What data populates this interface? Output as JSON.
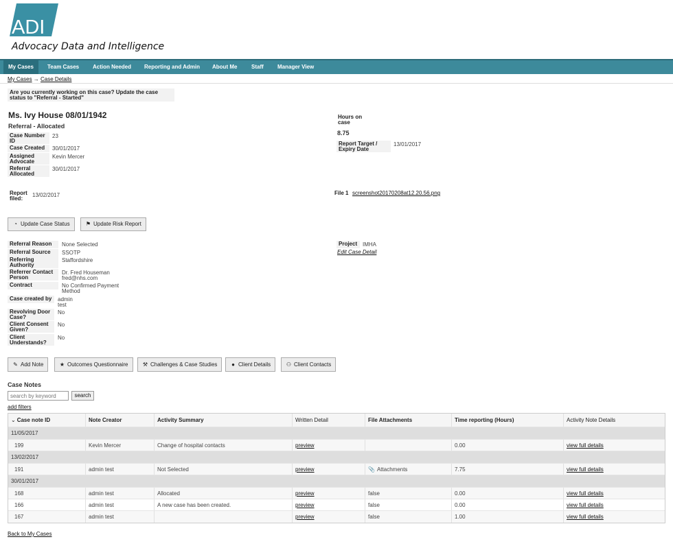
{
  "brand": {
    "logo_text": "ADI",
    "tagline": "Advocacy Data and Intelligence",
    "logo_color": "#3a90a4"
  },
  "nav": [
    "My Cases",
    "Team Cases",
    "Action Needed",
    "Reporting and Admin",
    "About Me",
    "Staff",
    "Manager View"
  ],
  "breadcrumb": {
    "root": "My Cases",
    "arrow": "→",
    "current": "Case Details"
  },
  "notice": "Are you currently working on this case? Update the case status to \"Referral - Started\"",
  "case": {
    "title": "Ms. Ivy House 08/01/1942",
    "status": "Referral - Allocated",
    "number_label": "Case Number ID",
    "number": "23",
    "created_label": "Case Created",
    "created": "30/01/2017",
    "advocate_label": "Assigned Advocate",
    "advocate": "Kevin Mercer",
    "allocated_label": "Referral Allocated",
    "allocated": "30/01/2017",
    "hours_label": "Hours on case",
    "hours": "8.75",
    "report_target_label": "Report Target / Expiry Date",
    "report_target": "13/01/2017",
    "report_filed_label": "Report filed:",
    "report_filed": "13/02/2017",
    "file_label": "File 1",
    "file_name": "screenshot20170208at12.20.56.png"
  },
  "actions_top": {
    "update_status": "Update Case Status",
    "update_risk": "Update Risk Report"
  },
  "referral": {
    "reason_label": "Referral Reason",
    "reason": "None Selected",
    "source_label": "Referral Source",
    "source": "SSOTP",
    "authority_label": "Referring Authority",
    "authority": "Staffordshire",
    "contact_label": "Referrer Contact Person",
    "contact_name": "Dr. Fred Houseman",
    "contact_email": "fred@nhs.com",
    "contract_label": "Contract",
    "contract": "No Confirmed Payment Method",
    "created_by_label": "Case created by",
    "created_by_1": "admin",
    "created_by_2": "test",
    "revolving_label": "Revolving Door Case?",
    "revolving": "No",
    "consent_label": "Client Consent Given?",
    "consent": "No",
    "understands_label": "Client Understands?",
    "understands": "No",
    "project_label": "Project",
    "project": "IMHA",
    "edit_link": "Edit Case Detail"
  },
  "actions_mid": {
    "add_note": "Add Note",
    "outcomes": "Outcomes Questionnaire",
    "challenges": "Challenges & Case Studies",
    "client_details": "Client Details",
    "client_contacts": "Client Contacts"
  },
  "notes": {
    "title": "Case Notes",
    "search_placeholder": "search by keyword",
    "search_button": "search",
    "add_filters": "add filters",
    "columns": [
      "Case note ID",
      "Note Creator",
      "Activity Summary",
      "Written Detail",
      "File Attachments",
      "Time reporting (Hours)",
      "Activity Note Details"
    ],
    "sort_indicator": "⌄",
    "groups": [
      {
        "date": "11/05/2017",
        "rows": [
          {
            "id": "199",
            "creator": "Kevin Mercer",
            "summary": "Change of hospital contacts",
            "detail": "preview",
            "attachments": "",
            "hours": "0.00",
            "link": "view full details"
          }
        ]
      },
      {
        "date": "13/02/2017",
        "rows": [
          {
            "id": "191",
            "creator": "admin test",
            "summary": "Not Selected",
            "detail": "preview",
            "attachments": "Attachments",
            "hours": "7.75",
            "link": "view full details"
          }
        ]
      },
      {
        "date": "30/01/2017",
        "rows": [
          {
            "id": "168",
            "creator": "admin test",
            "summary": "Allocated",
            "detail": "preview",
            "attachments": "false",
            "hours": "0.00",
            "link": "view full details"
          },
          {
            "id": "166",
            "creator": "admin test",
            "summary": "A new case has been created.",
            "detail": "preview",
            "attachments": "false",
            "hours": "0.00",
            "link": "view full details"
          },
          {
            "id": "167",
            "creator": "admin test",
            "summary": "",
            "detail": "preview",
            "attachments": "false",
            "hours": "1.00",
            "link": "view full details"
          }
        ]
      }
    ]
  },
  "back_link": "Back to My Cases"
}
